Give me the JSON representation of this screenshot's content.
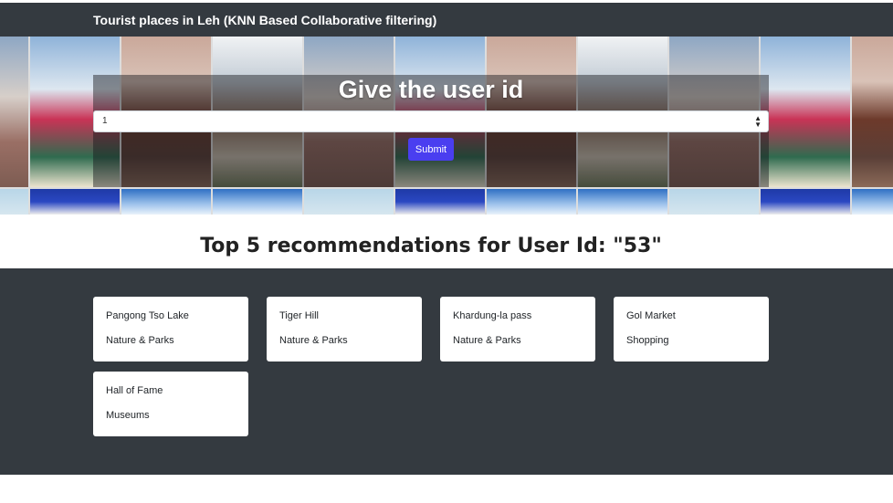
{
  "navbar": {
    "brand": "Tourist places in Leh (KNN Based Collaborative filtering)"
  },
  "form": {
    "title": "Give the user id",
    "selected_user": "1",
    "submit_label": "Submit"
  },
  "recommendations": {
    "heading": "Top 5 recommendations for User Id: \"53\"",
    "items": [
      {
        "name": "Pangong Tso Lake",
        "category": "Nature & Parks"
      },
      {
        "name": "Tiger Hill",
        "category": "Nature & Parks"
      },
      {
        "name": "Khardung-la pass",
        "category": "Nature & Parks"
      },
      {
        "name": "Gol Market",
        "category": "Shopping"
      },
      {
        "name": "Hall of Fame",
        "category": "Museums"
      }
    ]
  },
  "colors": {
    "navbar_bg": "#343a40",
    "accent_button": "#4a3ef0",
    "card_bg": "#ffffff"
  }
}
